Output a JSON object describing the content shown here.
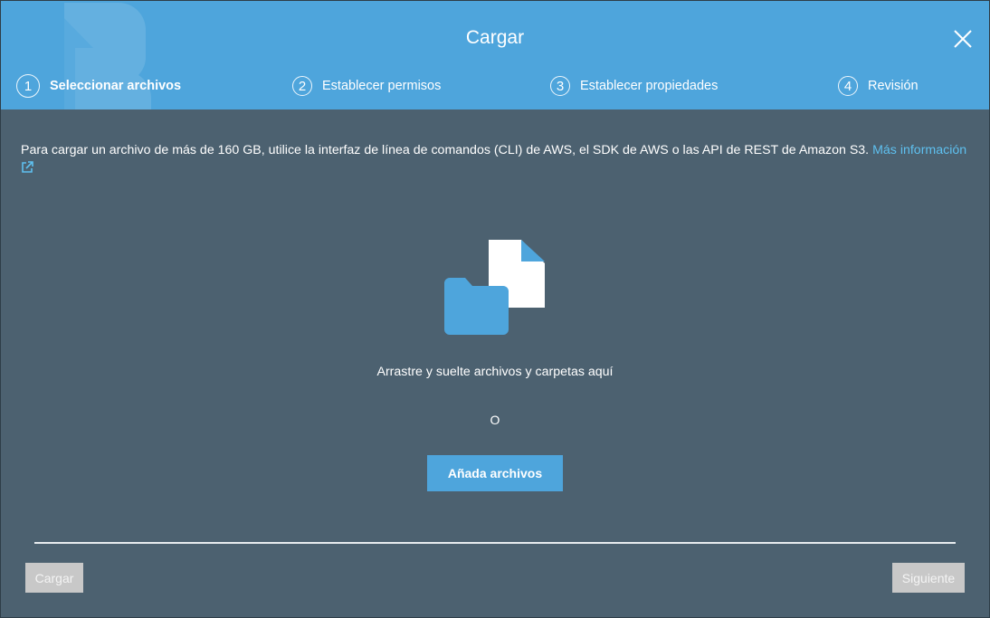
{
  "dialog": {
    "title": "Cargar",
    "close_icon": "close-icon",
    "colors": {
      "header": "#4ea5dc",
      "body": "#4c6170",
      "link": "#5ec0ef"
    }
  },
  "steps": [
    {
      "number": "1",
      "label": "Seleccionar archivos",
      "active": true
    },
    {
      "number": "2",
      "label": "Establecer permisos",
      "active": false
    },
    {
      "number": "3",
      "label": "Establecer propiedades",
      "active": false
    },
    {
      "number": "4",
      "label": "Revisión",
      "active": false
    }
  ],
  "notice": {
    "text": "Para cargar un archivo de más de 160 GB, utilice la interfaz de línea de comandos (CLI) de AWS, el SDK de AWS o las API de REST de Amazon S3.",
    "link_text": "Más información",
    "link_icon": "external-link-icon"
  },
  "dropzone": {
    "icon": "file-folder-icon",
    "text": "Arrastre y suelte archivos y carpetas aquí",
    "or_text": "O",
    "add_button": "Añada archivos"
  },
  "footer": {
    "upload_button": "Cargar",
    "next_button": "Siguiente"
  }
}
